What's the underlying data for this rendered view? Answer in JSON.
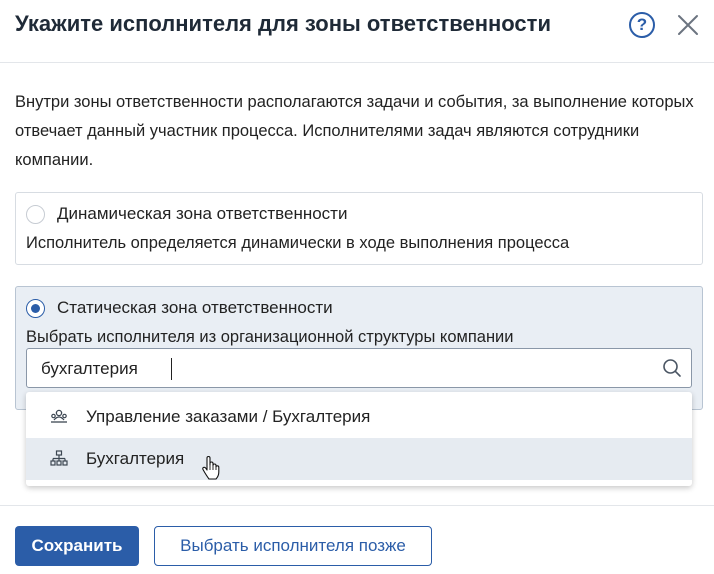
{
  "dialog": {
    "title": "Укажите исполнителя для зоны ответственности",
    "help_icon": "question-circle-icon",
    "help_glyph": "?",
    "close_icon": "close-icon"
  },
  "description": "Внутри зоны ответственности располагаются задачи и события, за выполнение которых отвечает данный участник процесса. Исполнителями задач являются сотрудники компании.",
  "options": [
    {
      "title": "Динамическая зона ответственности",
      "subtitle": "Исполнитель определяется динамически в ходе выполнения процесса",
      "selected": false
    },
    {
      "title": "Статическая зона ответственности",
      "subtitle": "Выбрать исполнителя из организационной структуры компании",
      "selected": true
    }
  ],
  "search": {
    "value": "бухгалтерия",
    "icon": "search-icon"
  },
  "dropdown": {
    "items": [
      {
        "label": "Управление заказами / Бухгалтерия",
        "icon": "group-icon",
        "hovered": false
      },
      {
        "label": "Бухгалтерия",
        "icon": "org-structure-icon",
        "hovered": true
      }
    ]
  },
  "footer": {
    "save_label": "Сохранить",
    "later_label": "Выбрать исполнителя позже"
  },
  "colors": {
    "accent": "#2b5da8",
    "selected_bg": "#e9eef4",
    "hover_bg": "#e6ebf1"
  }
}
